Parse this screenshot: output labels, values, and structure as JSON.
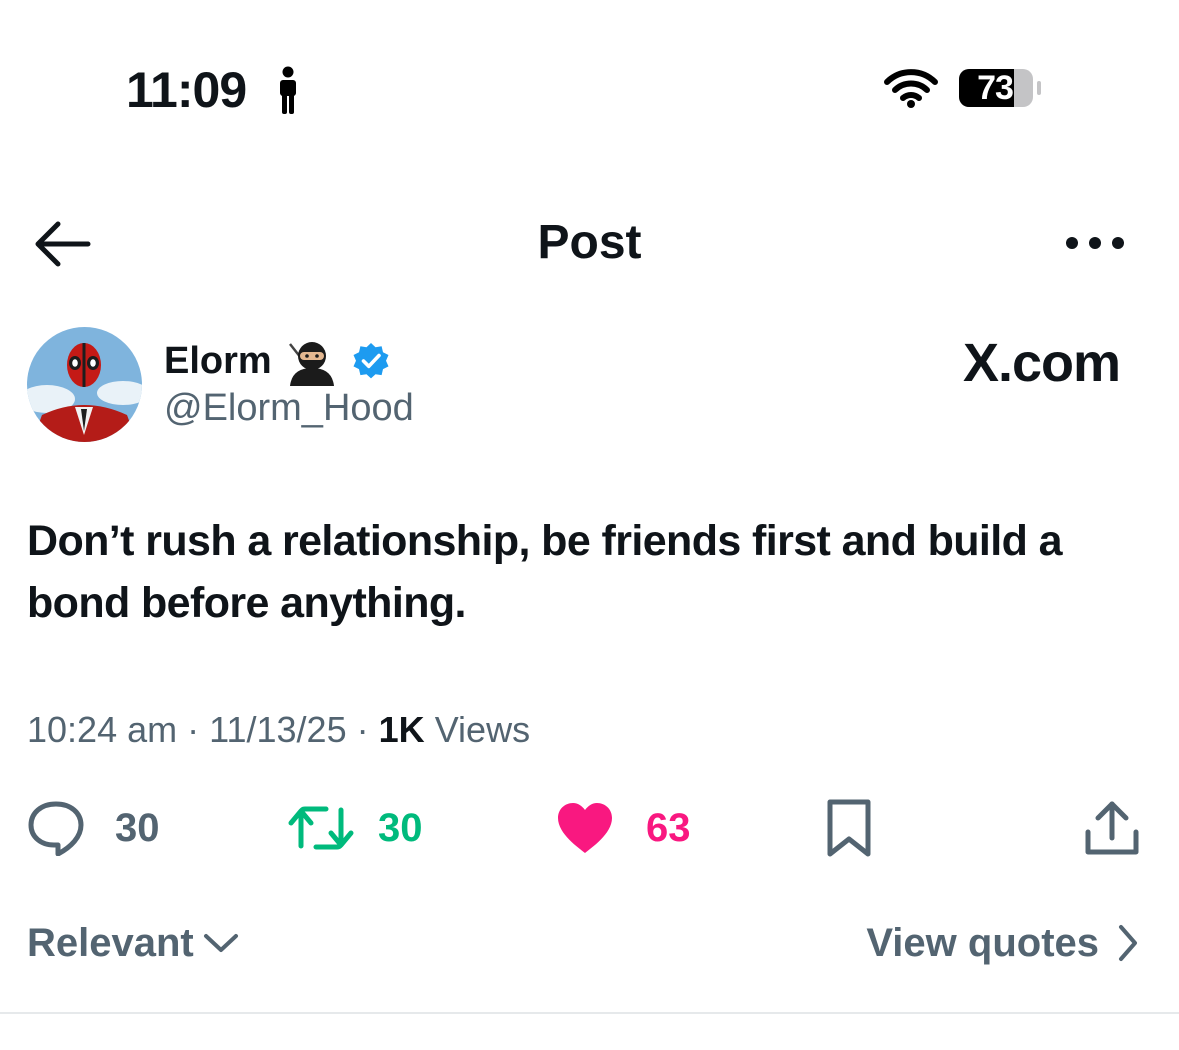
{
  "status_bar": {
    "time": "11:09",
    "battery": "73"
  },
  "header": {
    "title": "Post"
  },
  "author": {
    "display_name": "Elorm",
    "handle": "@Elorm_Hood",
    "verified": true
  },
  "watermark": "X.com",
  "post": {
    "text": "Don’t rush a relationship, be friends first and build a bond before anything."
  },
  "meta": {
    "time": "10:24 am",
    "separator": "·",
    "date": "11/13/25",
    "views_count": "1K",
    "views_label": "Views"
  },
  "actions": {
    "replies": "30",
    "reposts": "30",
    "likes": "63"
  },
  "replies_sort": {
    "label": "Relevant"
  },
  "view_quotes": {
    "label": "View quotes"
  },
  "colors": {
    "text": "#0f1419",
    "secondary": "#536471",
    "repost": "#00ba7c",
    "like": "#f91880",
    "verified": "#1d9bf0"
  },
  "icons": [
    "person-icon",
    "wifi-icon",
    "battery-icon",
    "back-arrow-icon",
    "more-icon",
    "ninja-icon",
    "verified-icon",
    "reply-icon",
    "repost-icon",
    "like-icon",
    "bookmark-icon",
    "share-icon",
    "chevron-down-icon",
    "chevron-right-icon"
  ]
}
